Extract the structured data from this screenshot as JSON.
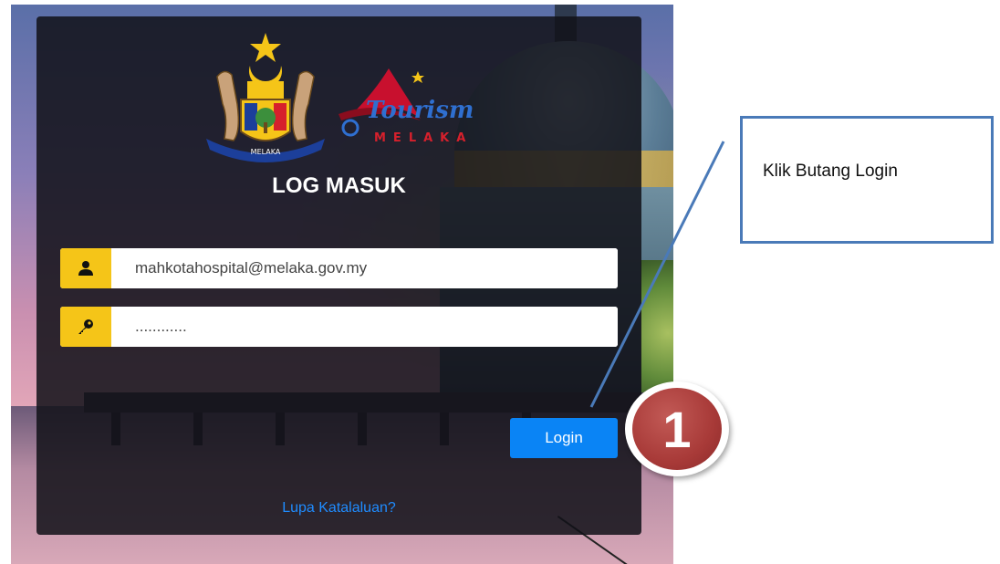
{
  "login_card": {
    "title": "LOG MASUK",
    "logos": {
      "crest_text": "MELAKA",
      "tourism_text": "Tourism",
      "tourism_subtext": "MELAKA"
    },
    "username": {
      "value": "mahkotahospital@melaka.gov.my",
      "icon": "user-icon"
    },
    "password": {
      "value": "............",
      "icon": "key-icon"
    },
    "login_button_label": "Login",
    "forgot_password_label": "Lupa Katalaluan?"
  },
  "annotation": {
    "callout_text": "Klik Butang Login",
    "step_number": "1",
    "callout_border_color": "#4a7ab8",
    "badge_color": "#a83a38"
  },
  "colors": {
    "icon_bg": "#f5c518",
    "button": "#0a84f5",
    "link": "#1f8cff"
  }
}
